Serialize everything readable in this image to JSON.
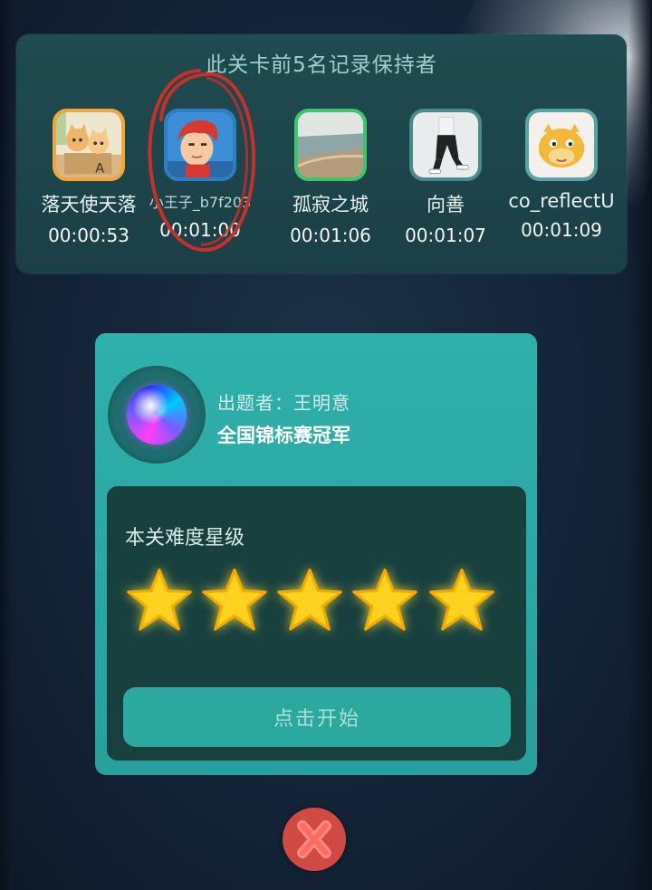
{
  "leaderboard": {
    "title": "此关卡前5名记录保持者",
    "players": [
      {
        "name": "落天使天落",
        "time": "00:00:53",
        "avatar_icon": "kittens-avatar-icon",
        "frame_color": "#f0a63a"
      },
      {
        "name": "小王子_b7f203",
        "time": "00:01:00",
        "avatar_icon": "cartoon-boy-avatar-icon",
        "frame_color": "#2c7fc4"
      },
      {
        "name": "孤寂之城",
        "time": "00:01:06",
        "avatar_icon": "beach-photo-avatar-icon",
        "frame_color": "#3fc56e"
      },
      {
        "name": "向善",
        "time": "00:01:07",
        "avatar_icon": "person-walking-avatar-icon",
        "frame_color": "#4a8a8a"
      },
      {
        "name": "co_reflectU",
        "time": "00:01:09",
        "avatar_icon": "cartoon-creature-avatar-icon",
        "frame_color": "#5aa3a3"
      }
    ]
  },
  "card": {
    "author_label": "出题者：王明意",
    "author_title": "全国锦标赛冠军",
    "difficulty_label": "本关难度星级",
    "difficulty_stars": 5,
    "start_label": "点击开始"
  },
  "colors": {
    "panel_bg": "#1f4c50",
    "card_bg": "#2fb0ab",
    "star": "#ffd21f",
    "close_button": "#d04a44",
    "annotation_circle": "#c7302a"
  }
}
